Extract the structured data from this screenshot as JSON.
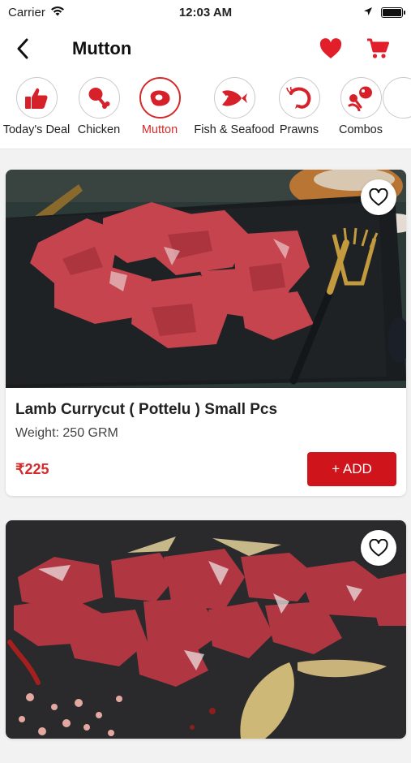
{
  "status_bar": {
    "carrier": "Carrier",
    "time": "12:03 AM",
    "battery_level": 1.0
  },
  "nav": {
    "title": "Mutton",
    "icons": [
      "back-arrow-icon",
      "heart-icon",
      "cart-icon"
    ]
  },
  "categories": [
    {
      "label": "Today's Deal",
      "icon": "thumbs-up-icon",
      "active": false
    },
    {
      "label": "Chicken",
      "icon": "drumstick-icon",
      "active": false
    },
    {
      "label": "Mutton",
      "icon": "meat-steak-icon",
      "active": true
    },
    {
      "label": "Fish & Seafood",
      "icon": "fish-icon",
      "active": false
    },
    {
      "label": "Prawns",
      "icon": "prawn-icon",
      "active": false
    },
    {
      "label": "Combos",
      "icon": "combo-icon",
      "active": false
    }
  ],
  "products": [
    {
      "name": "Lamb Currycut ( Pottelu ) Small Pcs",
      "weight": "Weight: 250 GRM",
      "price": "₹225",
      "add_label": "+ ADD"
    },
    {
      "name": "",
      "weight": "",
      "price": "",
      "add_label": ""
    }
  ],
  "colors": {
    "accent": "#d32a2a",
    "button": "#d0141b"
  }
}
